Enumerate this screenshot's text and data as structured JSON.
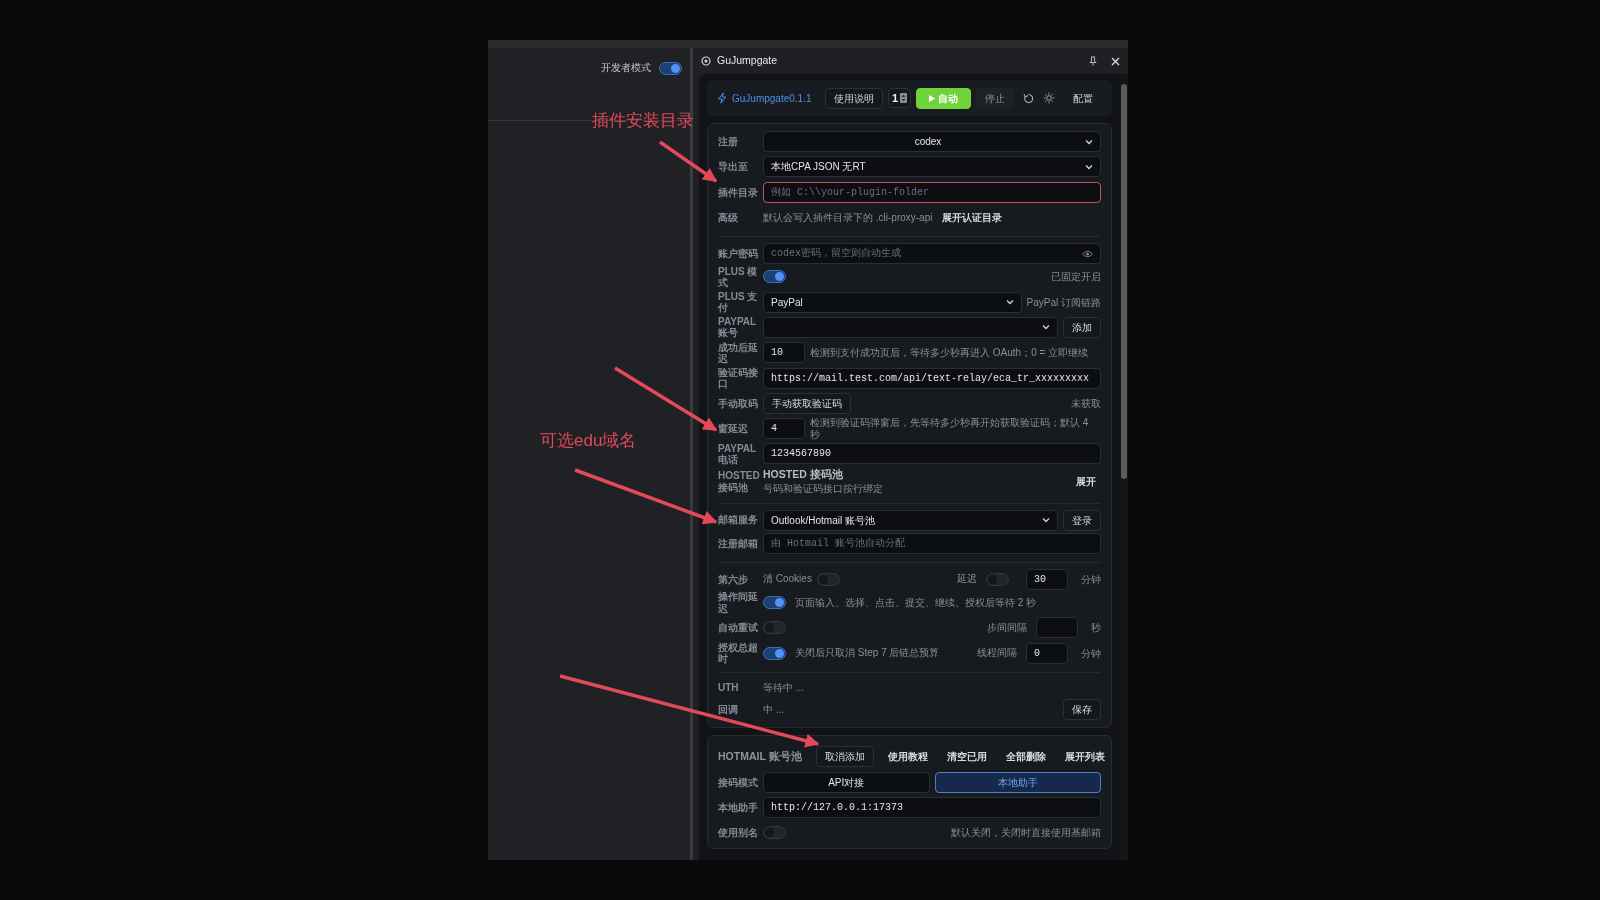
{
  "annotations": [
    {
      "text": "插件安装目录"
    },
    {
      "text": "可选edu域名"
    }
  ],
  "developer_mode": {
    "label": "开发者模式",
    "on": true
  },
  "panel": {
    "title": "GuJumpgate"
  },
  "app_header": {
    "name": "GuJumpgate0.1.1",
    "guide_button": "使用说明",
    "count": "1",
    "auto_button": "自动",
    "stop_button": "停止",
    "config_button": "配置"
  },
  "form": [
    {
      "kind": "select",
      "label": "注册",
      "value": "codex",
      "centered": true
    },
    {
      "kind": "select",
      "label": "导出至",
      "value": "本地CPA JSON 无RT"
    },
    {
      "kind": "input",
      "label": "插件目录",
      "placeholder": "例如 C:\\\\your-plugin-folder",
      "invalid": true
    },
    {
      "kind": "note",
      "label": "高级",
      "text": "默认会写入插件目录下的 .cli-proxy-api",
      "button": "展开认证目录"
    },
    {
      "kind": "password",
      "label": "账户密码",
      "placeholder": "codex密码，留空则自动生成",
      "divider_before": true
    },
    {
      "kind": "toggle",
      "label": "PLUS 模式",
      "on": true,
      "side": "已固定开启"
    },
    {
      "kind": "select",
      "label": "PLUS 支付",
      "value": "PayPal",
      "side": "PayPal 订阅链路"
    },
    {
      "kind": "select",
      "label": "PAYPAL 账号",
      "button": "添加"
    },
    {
      "kind": "number",
      "label": "成功后延迟",
      "value": "10",
      "note": "检测到支付成功页后，等待多少秒再进入 OAuth；0 = 立即继续"
    },
    {
      "kind": "input",
      "label": "验证码接口",
      "value": "https://mail.test.com/api/text-relay/eca_tr_xxxxxxxxx"
    },
    {
      "kind": "action",
      "label": "手动取码",
      "button": "手动获取验证码",
      "side": "未获取"
    },
    {
      "kind": "number",
      "label": "窗延迟",
      "value": "4",
      "note": "检测到验证码弹窗后，先等待多少秒再开始获取验证码；默认 4 秒"
    },
    {
      "kind": "input",
      "label": "PAYPAL 电话",
      "value": "1234567890"
    },
    {
      "kind": "section",
      "label": "HOSTED 接码池",
      "title": "HOSTED 接码池",
      "subtitle": "号码和验证码接口按行绑定",
      "button": "展开"
    },
    {
      "kind": "select",
      "label": "邮箱服务",
      "value": "Outlook/Hotmail 账号池",
      "button": "登录",
      "divider_before": true
    },
    {
      "kind": "input",
      "label": "注册邮箱",
      "placeholder": "由 Hotmail 账号池自动分配"
    },
    {
      "kind": "step",
      "label": "第六步",
      "toggle_label": "清 Cookies",
      "on": false,
      "delay_label": "延迟",
      "delay_on": false,
      "value": "30",
      "unit": "分钟",
      "divider_before": true
    },
    {
      "kind": "toggle",
      "label": "操作间延迟",
      "on": true,
      "note": "页面输入、选择、点击、提交、继续、授权后等待 2 秒"
    },
    {
      "kind": "toggle",
      "label": "自动重试",
      "on": false,
      "field_label": "步间间隔",
      "unit": "秒"
    },
    {
      "kind": "toggle",
      "label": "授权总超时",
      "on": true,
      "note": "关闭后只取消 Step 7 后链总预算",
      "field_label": "线程间隔",
      "value": "0",
      "unit": "分钟"
    },
    {
      "kind": "status",
      "label": "UTH",
      "text": "等待中 ...",
      "divider_before": true
    },
    {
      "kind": "status",
      "label": "回调",
      "text": "中 ...",
      "button": "保存"
    }
  ],
  "hotmail": {
    "title": "HOTMAIL 账号池",
    "buttons": [
      {
        "label": "取消添加",
        "outlined": true
      },
      {
        "label": "使用教程"
      },
      {
        "label": "清空已用"
      },
      {
        "label": "全部删除"
      },
      {
        "label": "展开列表"
      }
    ],
    "rows": [
      {
        "kind": "segmented",
        "label": "接码模式",
        "options": [
          {
            "label": "API对接",
            "selected": false
          },
          {
            "label": "本地助手",
            "selected": true
          }
        ]
      },
      {
        "kind": "input",
        "label": "本地助手",
        "value": "http://127.0.0.1:17373"
      },
      {
        "kind": "toggle",
        "label": "使用别名",
        "on": false,
        "side": "默认关闭，关闭时直接使用基邮箱"
      }
    ]
  }
}
